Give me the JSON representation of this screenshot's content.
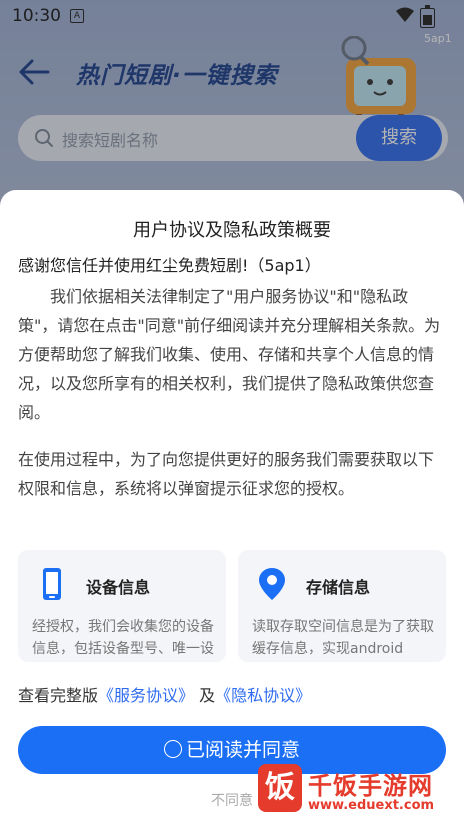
{
  "status_bar": {
    "time": "10:30",
    "badge": "A",
    "version": "5ap1"
  },
  "header": {
    "title": "热门短剧·一键搜索"
  },
  "search": {
    "placeholder": "搜索短剧名称",
    "button_label": "搜索"
  },
  "dialog": {
    "title": "用户协议及隐私政策概要",
    "thanks": "感谢您信任并使用红尘免费短剧!（5ap1）",
    "paragraph1": "我们依据相关法律制定了\"用户服务协议\"和\"隐私政策\"，请您在点击\"同意\"前仔细阅读并充分理解相关条款。为方便帮助您了解我们收集、使用、存储和共享个人信息的情况，以及您所享有的相关权利，我们提供了隐私政策供您查阅。",
    "paragraph2": "在使用过程中，为了向您提供更好的服务我们需要获取以下权限和信息，系统将以弹窗提示征求您的授权。",
    "cards": [
      {
        "icon": "phone-icon",
        "title": "设备信息",
        "desc": "经授权，我们会收集您的设备信息，包括设备型号、唯一设备标识符"
      },
      {
        "icon": "location-pin-icon",
        "title": "存储信息",
        "desc": "读取存取空间信息是为了获取缓存信息，实现android"
      }
    ],
    "links_prefix": "查看完整版",
    "link_service": "《服务协议》",
    "links_and": "及",
    "link_privacy": "《隐私协议》",
    "agree_label": "已阅读并同意",
    "disagree_label": "不同意"
  },
  "watermark": {
    "logo_char": "饭",
    "name": "千饭手游网",
    "url": "www.eduext.com"
  },
  "colors": {
    "accent": "#1a6ff5",
    "header_title": "#1b3e8c",
    "watermark": "#e53b2c"
  }
}
